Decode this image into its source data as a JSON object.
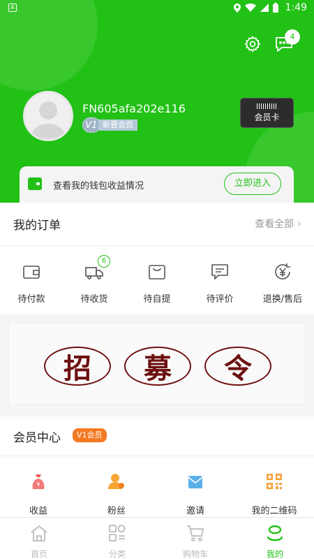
{
  "status_bar": {
    "time": "1:49"
  },
  "header": {
    "message_badge_count": "4",
    "username": "FN605afa202e116",
    "level_code": "V1",
    "level_name": "新晋会员",
    "member_card_label": "会员卡",
    "wallet": {
      "text": "查看我的钱包收益情况",
      "button": "立即进入"
    }
  },
  "orders": {
    "title": "我的订单",
    "more": "查看全部",
    "items": [
      {
        "label": "待付款",
        "icon": "wallet-icon"
      },
      {
        "label": "待收货",
        "icon": "truck-icon",
        "badge": "6"
      },
      {
        "label": "待自提",
        "icon": "shopping-bag-icon"
      },
      {
        "label": "待评价",
        "icon": "comment-icon"
      },
      {
        "label": "退换/售后",
        "icon": "refund-icon"
      }
    ]
  },
  "banner": {
    "seals": [
      "招",
      "募",
      "令"
    ]
  },
  "member_center": {
    "title": "会员中心",
    "badge": "V1会员",
    "items": [
      {
        "label": "收益",
        "icon": "money-bag-icon"
      },
      {
        "label": "粉丝",
        "icon": "fans-icon"
      },
      {
        "label": "邀请",
        "icon": "invite-icon"
      },
      {
        "label": "我的二维码",
        "icon": "qr-code-icon"
      }
    ]
  },
  "bottom_nav": [
    {
      "label": "首页",
      "icon": "home-icon",
      "active": false
    },
    {
      "label": "分类",
      "icon": "category-icon",
      "active": false
    },
    {
      "label": "购物车",
      "icon": "cart-icon",
      "active": false
    },
    {
      "label": "我的",
      "icon": "profile-icon",
      "active": true
    }
  ],
  "colors": {
    "brand_green": "#22c116",
    "badge_orange": "#f47920",
    "seal_red": "#6d1010"
  }
}
